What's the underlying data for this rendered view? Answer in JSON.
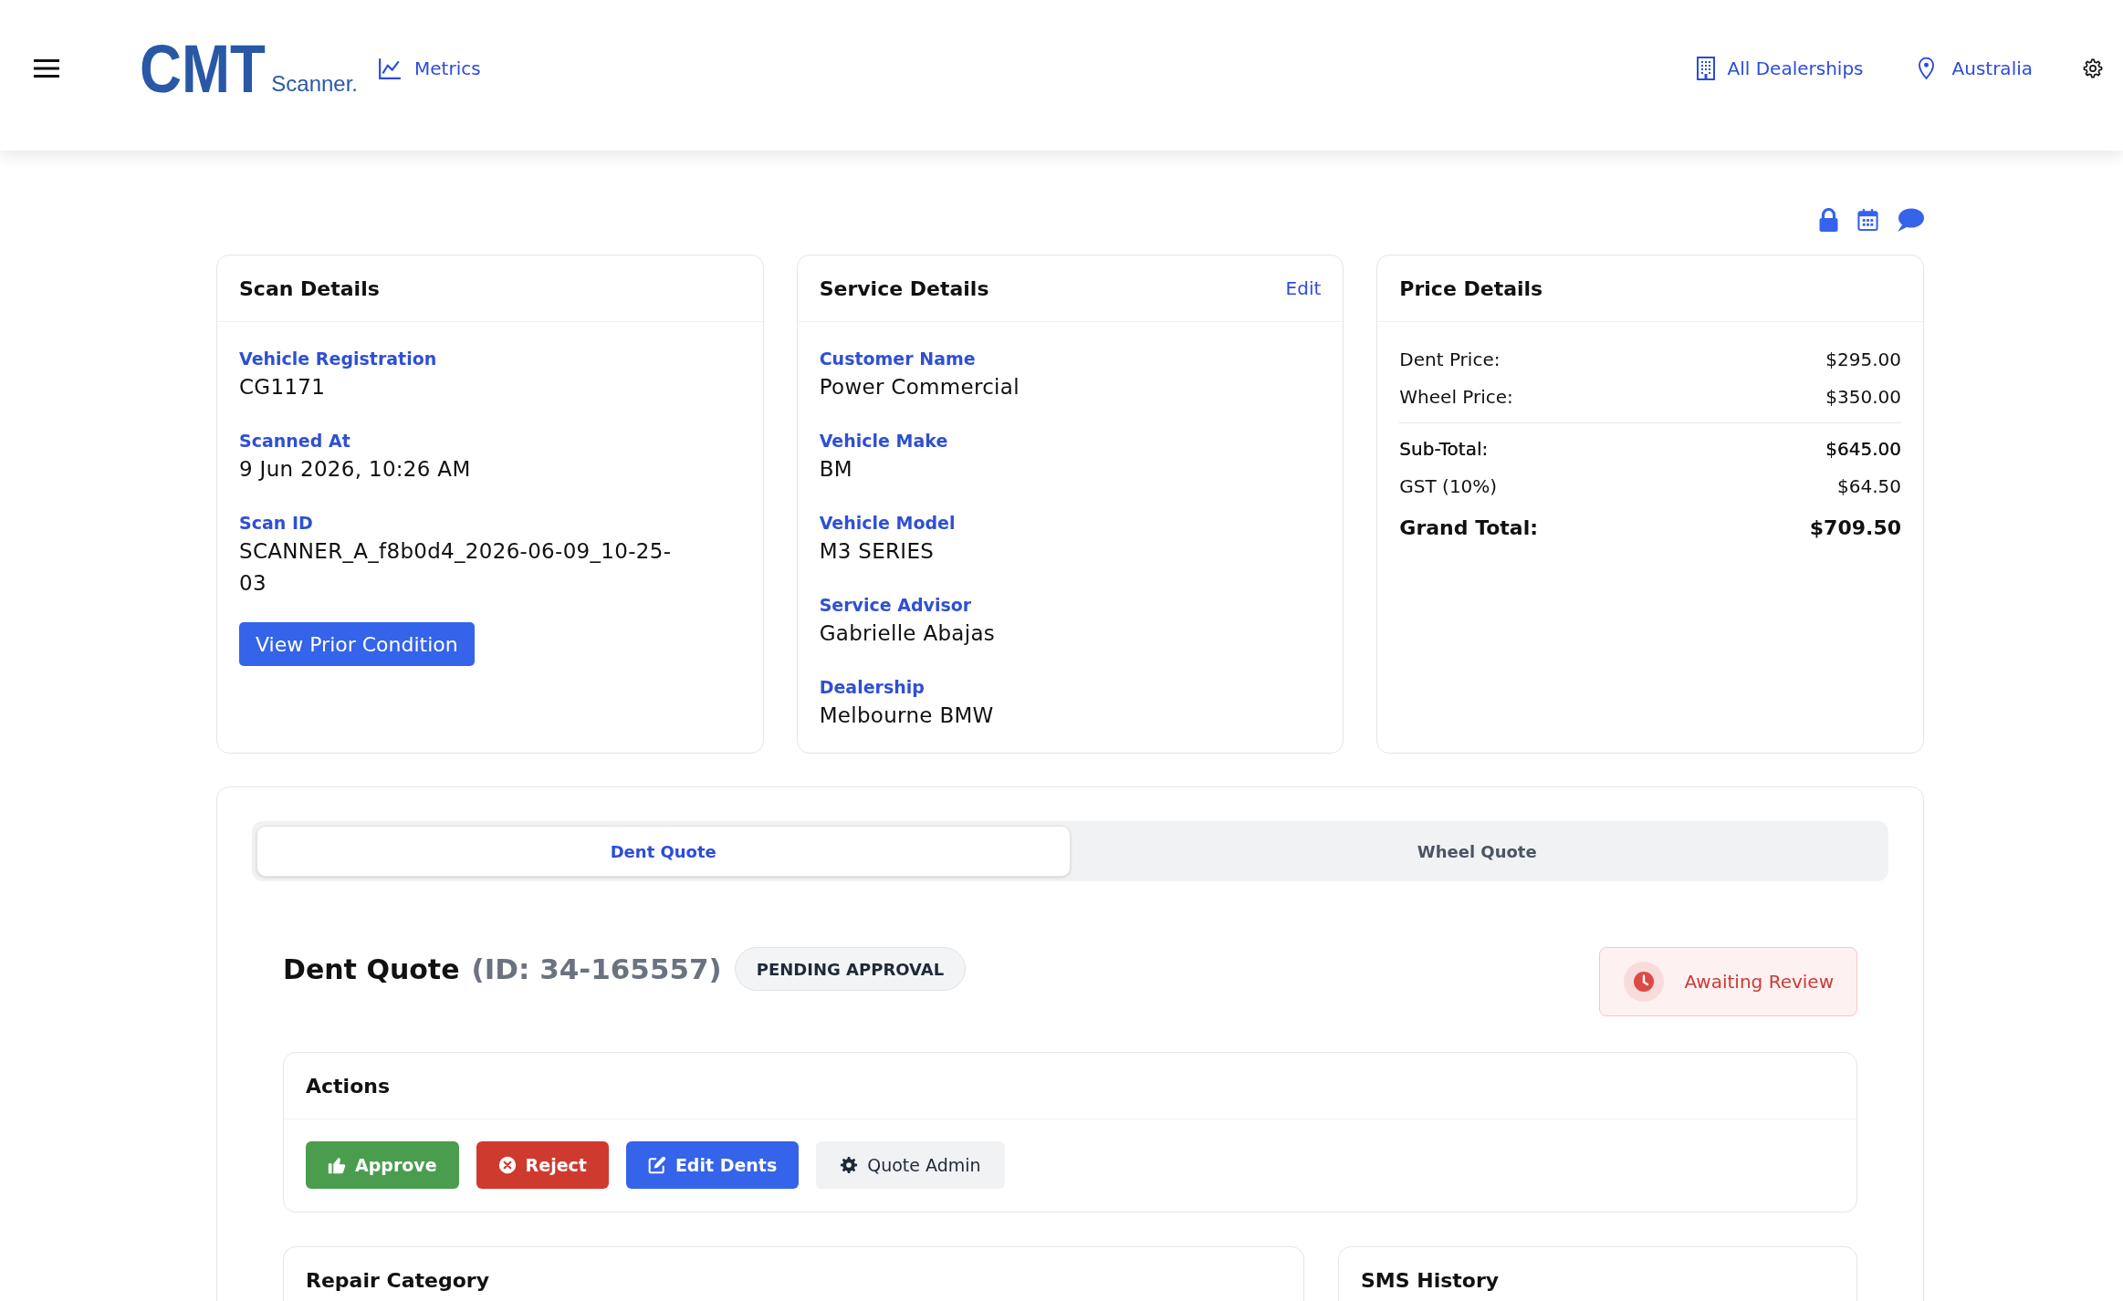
{
  "header": {
    "logo": {
      "mark": "CMT",
      "wordmark": "Scanner."
    },
    "metrics_link": "Metrics",
    "dealership_filter": "All Dealerships",
    "region_filter": "Australia"
  },
  "scan_details": {
    "title": "Scan Details",
    "fields": [
      {
        "label": "Vehicle Registration",
        "value": "CG1171"
      },
      {
        "label": "Scanned At",
        "value": "9 Jun 2026, 10:26 AM"
      },
      {
        "label": "Scan ID",
        "value": "SCANNER_A_f8b0d4_2026-06-09_10-25-03"
      }
    ],
    "button": "View Prior Condition"
  },
  "service_details": {
    "title": "Service Details",
    "edit_link": "Edit",
    "fields": [
      {
        "label": "Customer Name",
        "value": "Power Commercial"
      },
      {
        "label": "Vehicle Make",
        "value": "BM"
      },
      {
        "label": "Vehicle Model",
        "value": "M3 SERIES"
      },
      {
        "label": "Service Advisor",
        "value": "Gabrielle Abajas"
      },
      {
        "label": "Dealership",
        "value": "Melbourne BMW"
      }
    ]
  },
  "price_details": {
    "title": "Price Details",
    "rows": [
      {
        "kind": "item",
        "label": "Dent Price:",
        "value": "$295.00"
      },
      {
        "kind": "item",
        "label": "Wheel Price:",
        "value": "$350.00"
      },
      {
        "kind": "subtotal",
        "label": "Sub-Total:",
        "value": "$645.00"
      },
      {
        "kind": "item",
        "label": "GST (10%)",
        "value": "$64.50"
      },
      {
        "kind": "total",
        "label": "Grand Total:",
        "value": "$709.50"
      }
    ]
  },
  "quote_tabs": [
    {
      "label": "Dent Quote",
      "selected": true
    },
    {
      "label": "Wheel Quote",
      "selected": false
    }
  ],
  "quote": {
    "title": "Dent Quote",
    "id": "(ID: 34-165557)",
    "status_badge": "PENDING APPROVAL",
    "review_status": "Awaiting Review"
  },
  "actions": {
    "title": "Actions",
    "buttons": [
      {
        "kind": "approve",
        "label": "Approve"
      },
      {
        "kind": "reject",
        "label": "Reject"
      },
      {
        "kind": "edit",
        "label": "Edit Dents"
      },
      {
        "kind": "admin",
        "label": "Quote Admin"
      }
    ]
  },
  "lower_panels": [
    {
      "title": "Repair Category"
    },
    {
      "title": "SMS History"
    }
  ]
}
